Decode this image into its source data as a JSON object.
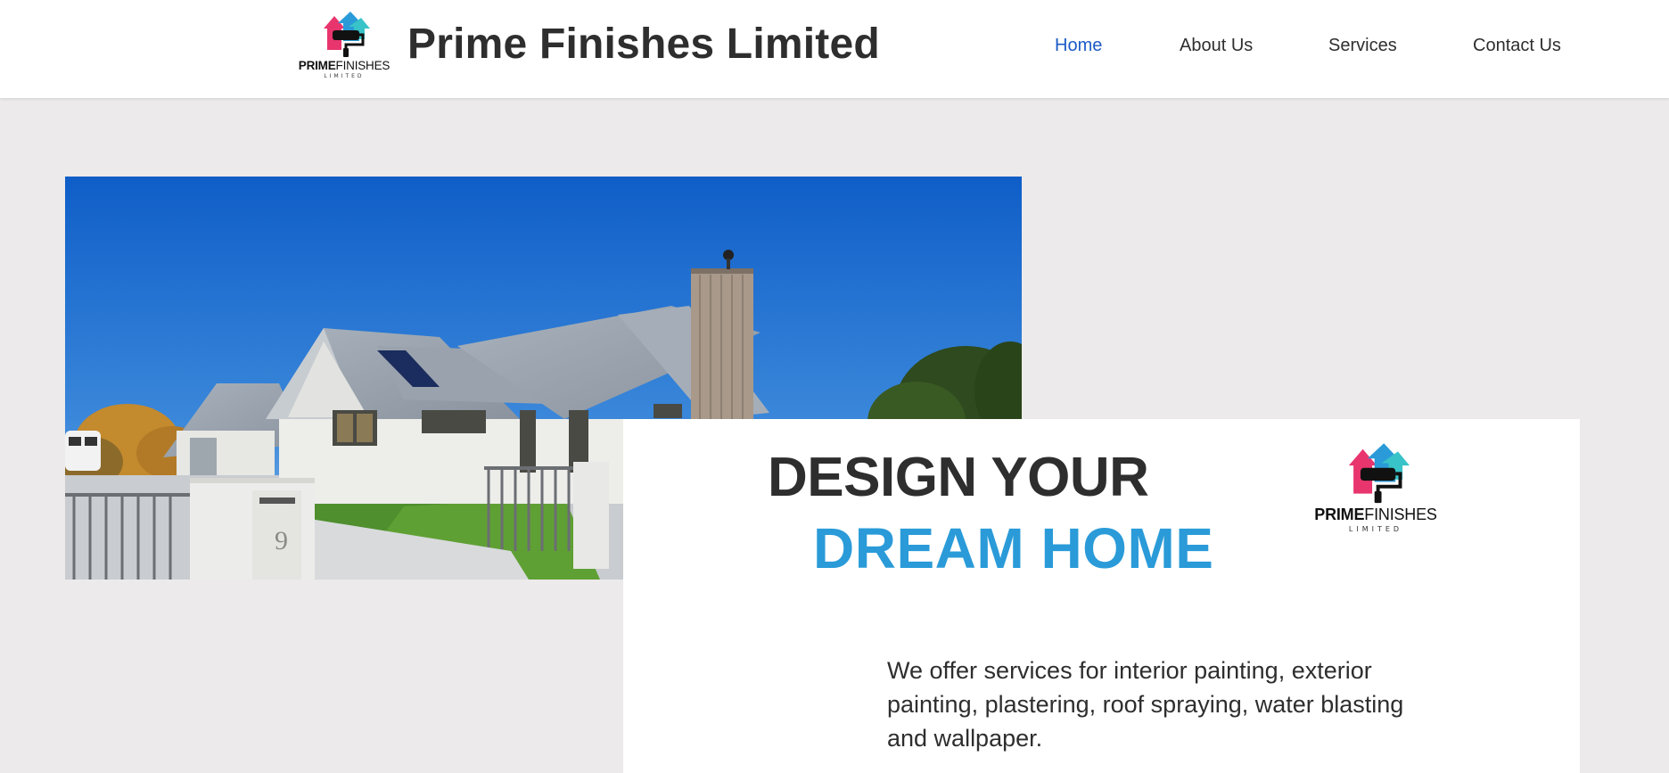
{
  "site": {
    "title": "Prime Finishes Limited",
    "logo": {
      "brand_bold": "PRIME",
      "brand_regular": "FINISHES",
      "brand_sub": "LIMITED",
      "colors": {
        "pink": "#E8356E",
        "blue": "#2A9BD8",
        "teal": "#38C3C8",
        "black": "#111111"
      }
    }
  },
  "nav": {
    "items": [
      {
        "label": "Home",
        "active": true
      },
      {
        "label": "About Us",
        "active": false
      },
      {
        "label": "Services",
        "active": false
      },
      {
        "label": "Contact Us",
        "active": false
      }
    ]
  },
  "hero": {
    "image_alt": "house photo",
    "house_number": "9",
    "headline_line1": "DESIGN YOUR",
    "headline_line2": "DREAM HOME",
    "description": "We offer services for interior painting, exterior painting, plastering, roof spraying, water blasting and wallpaper."
  },
  "colors": {
    "page_background": "#ECEAEA",
    "nav_active": "#1E5BC6",
    "accent_blue": "#2A9BD8",
    "text_dark": "#2E2E2E"
  }
}
